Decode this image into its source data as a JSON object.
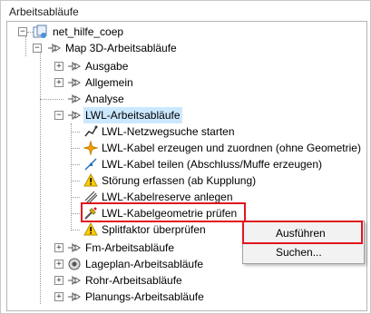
{
  "panel": {
    "title": "Arbeitsabläufe"
  },
  "tree": {
    "root": "net_hilfe_coep",
    "map3d": "Map 3D-Arbeitsabläufe",
    "ausgabe": "Ausgabe",
    "allgemein": "Allgemein",
    "analyse": "Analyse",
    "lwl": "LWL-Arbeitsabläufe",
    "lwl_items": [
      "LWL-Netzwegsuche starten",
      "LWL-Kabel erzeugen und zuordnen (ohne Geometrie)",
      "LWL-Kabel teilen (Abschluss/Muffe erzeugen)",
      "Störung erfassen (ab Kupplung)",
      "LWL-Kabelreserve anlegen",
      "LWL-Kabelgeometrie prüfen",
      "Splitfaktor überprüfen"
    ],
    "fm": "Fm-Arbeitsabläufe",
    "lageplan": "Lageplan-Arbeitsabläufe",
    "rohr": "Rohr-Arbeitsabläufe",
    "planung": "Planungs-Arbeitsabläufe"
  },
  "context_menu": {
    "run": "Ausführen",
    "search": "Suchen..."
  },
  "colors": {
    "highlight": "#e0161e",
    "selection": "#cce8ff"
  }
}
